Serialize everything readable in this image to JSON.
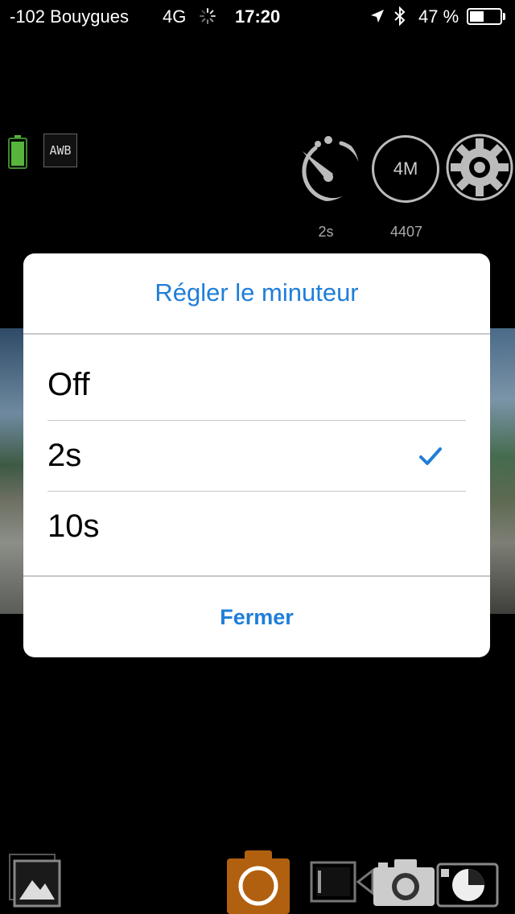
{
  "status_bar": {
    "carrier": "-102 Bouygues",
    "network": "4G",
    "time": "17:20",
    "battery_percent": "47 %",
    "battery_level": 0.47,
    "icons": [
      "activity-spinner-icon",
      "location-arrow-icon",
      "bluetooth-icon",
      "battery-icon"
    ]
  },
  "camera_controls": {
    "awb_label": "AWB",
    "timer_value": "2s",
    "photo_size_label": "4M",
    "remaining_shots": "4407",
    "icons": [
      "camera-battery-icon",
      "self-timer-icon",
      "gear-icon"
    ],
    "camera_battery_color": "#57b53c"
  },
  "dialog": {
    "title": "Régler le minuteur",
    "options": [
      {
        "label": "Off",
        "selected": false
      },
      {
        "label": "2s",
        "selected": true
      },
      {
        "label": "10s",
        "selected": false
      }
    ],
    "close_label": "Fermer",
    "accent_color": "#1f7ed8"
  },
  "bottom_bar": {
    "modes": [
      "gallery-icon",
      "photo-camera-icon",
      "video-camera-icon",
      "photo-camera-inactive-icon",
      "timelapse-icon"
    ],
    "active_mode_color": "#b1600f"
  }
}
